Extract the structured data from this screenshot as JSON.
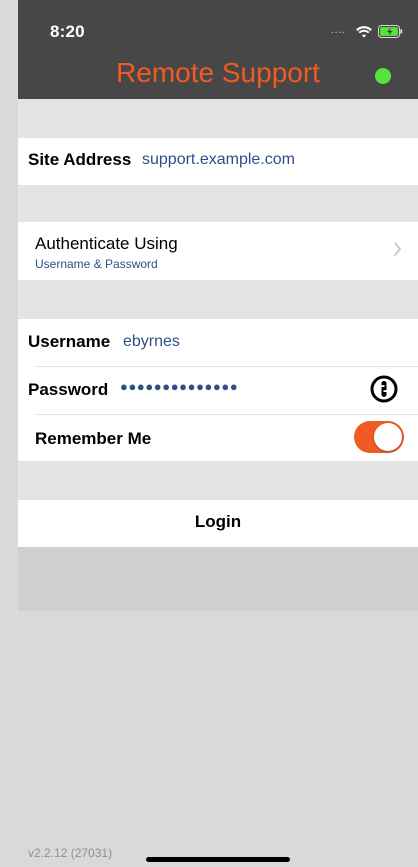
{
  "status_bar": {
    "time": "8:20",
    "signal_dots": "....",
    "wifi_icon": "wifi-icon",
    "battery_icon": "battery-charging-icon"
  },
  "header": {
    "title": "Remote Support",
    "status_dot_color": "#57e33e"
  },
  "site_address": {
    "label": "Site Address",
    "value": "support.example.com"
  },
  "authentication": {
    "title": "Authenticate Using",
    "subtitle": "Username & Password",
    "chevron_icon": "chevron-right-icon"
  },
  "credentials": {
    "username_label": "Username",
    "username_value": "ebyrnes",
    "password_label": "Password",
    "password_value": "●●●●●●●●●●●●●●",
    "remember_label": "Remember Me",
    "remember_enabled": true
  },
  "actions": {
    "login_label": "Login"
  },
  "footer": {
    "version": "v2.2.12 (27031)"
  },
  "colors": {
    "accent": "#f05a24",
    "header_bg": "#474747",
    "value_text": "#2f4f88",
    "background": "#d9d9d9"
  }
}
